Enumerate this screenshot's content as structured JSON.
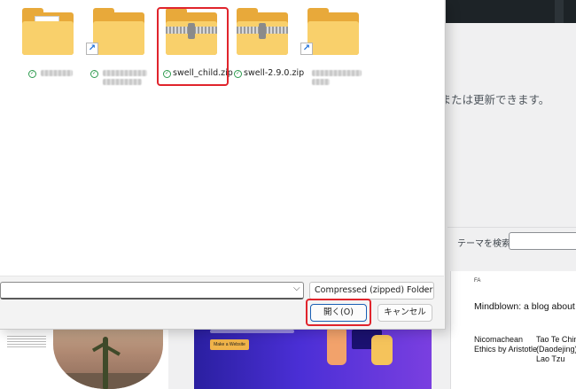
{
  "background": {
    "upload_text": "ルまたは更新できます。",
    "search_label": "テーマを検索",
    "theme_right": {
      "fa_label": "FA",
      "blog_title": "Mindblown: a blog about ph",
      "post1": "Nicomachean Ethics by Aristotle",
      "post2": "Tao Te Ching (Daodejing) Lao Tzu"
    },
    "theme_mid": {
      "button_label": "Make a Website"
    }
  },
  "dialog": {
    "files": [
      {
        "name": "",
        "type": "folder-with-doc",
        "shortcut": false
      },
      {
        "name": "",
        "type": "folder",
        "shortcut": true
      },
      {
        "name": "swell_child.zip",
        "type": "zip",
        "shortcut": false
      },
      {
        "name": "swell-2.9.0.zip",
        "type": "zip",
        "shortcut": false
      },
      {
        "name": "",
        "type": "folder",
        "shortcut": true
      }
    ],
    "filename_value": "",
    "filetype": "Compressed (zipped) Folder (*.z",
    "open_button": "開く(O)",
    "cancel_button": "キャンセル",
    "colors": {
      "highlight": "#e0242c",
      "folder_front": "#f9d06b",
      "folder_back": "#e8a93a",
      "sync_ok": "#2e9b4f",
      "primary_border": "#1a5fb4"
    }
  }
}
